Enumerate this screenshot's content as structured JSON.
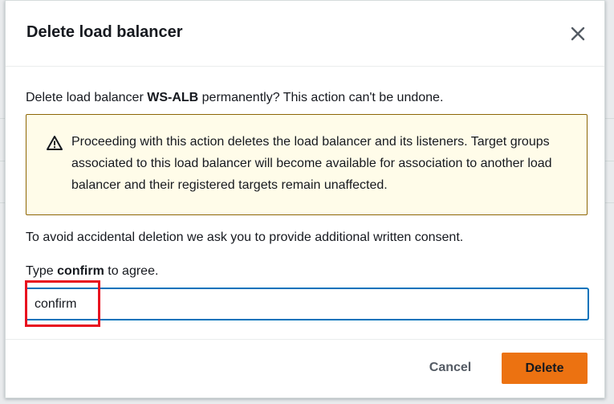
{
  "modal": {
    "title": "Delete load balancer",
    "close_icon": "close-icon"
  },
  "body": {
    "prefix": "Delete load balancer ",
    "name": "WS-ALB",
    "suffix": " permanently? This action can't be undone."
  },
  "alert": {
    "icon": "warning-icon",
    "text": "Proceeding with this action deletes the load balancer and its listeners. Target groups associated to this load balancer will become available for association to another load balancer and their registered targets remain unaffected."
  },
  "consent": {
    "text": "To avoid accidental deletion we ask you to provide additional written consent."
  },
  "type_label": {
    "prefix": "Type ",
    "keyword": "confirm",
    "suffix": " to agree."
  },
  "confirm_input": {
    "value": "confirm"
  },
  "footer": {
    "cancel_label": "Cancel",
    "delete_label": "Delete"
  },
  "colors": {
    "accent": "#ec7211",
    "focus": "#0073bb",
    "warning_border": "#8d6605",
    "warning_bg": "#fffce9",
    "annotation": "#e8101f"
  }
}
